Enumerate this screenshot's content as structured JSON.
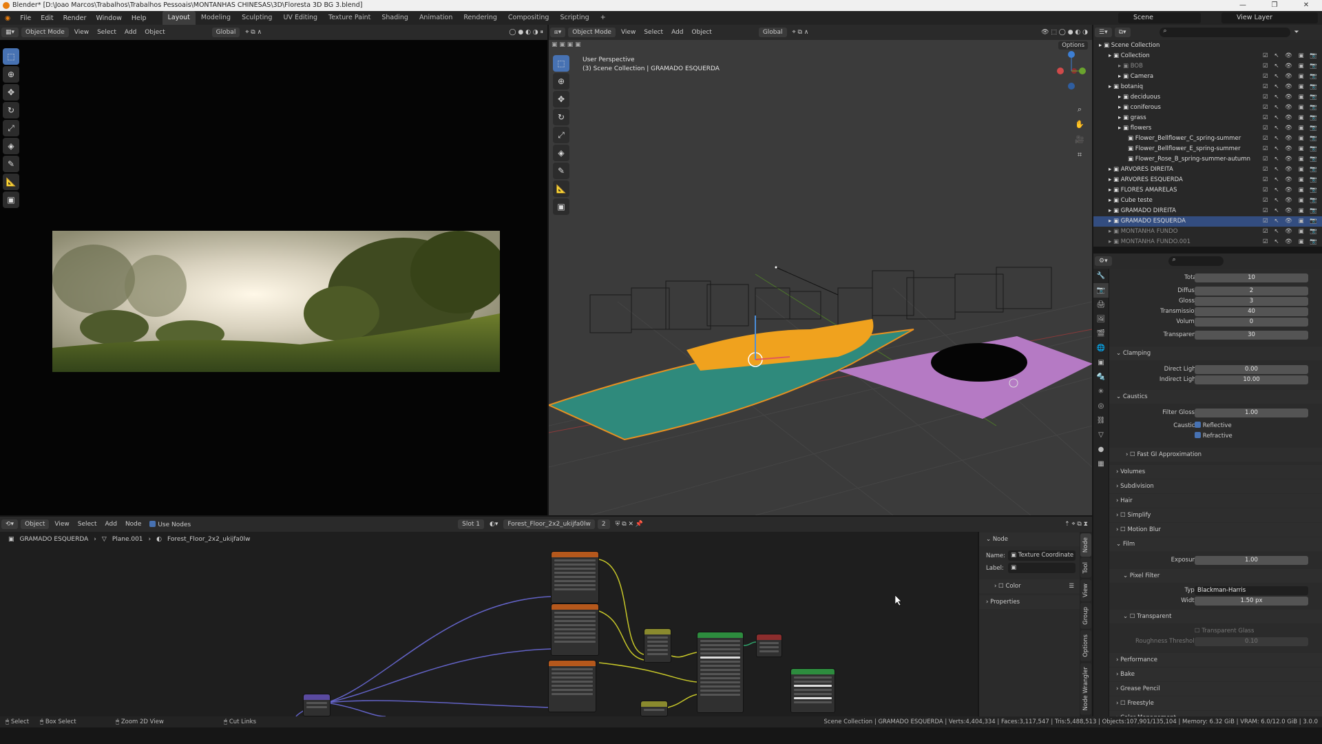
{
  "window": {
    "title": "Blender* [D:\\Joao Marcos\\Trabalhos\\Trabalhos Pessoais\\MONTANHAS CHINESAS\\3D\\Floresta 3D BG 3.blend]"
  },
  "menu": [
    "File",
    "Edit",
    "Render",
    "Window",
    "Help"
  ],
  "workspaces": [
    "Layout",
    "Modeling",
    "Sculpting",
    "UV Editing",
    "Texture Paint",
    "Shading",
    "Animation",
    "Rendering",
    "Compositing",
    "Scripting",
    "+"
  ],
  "top_right": {
    "scene": "Scene",
    "view_layer": "View Layer"
  },
  "left_header": {
    "mode": "Object Mode",
    "view": "View",
    "select": "Select",
    "add": "Add",
    "object": "Object",
    "orientation": "Global"
  },
  "viewport": {
    "mode": "Object Mode",
    "view": "View",
    "select": "Select",
    "add": "Add",
    "object": "Object",
    "orientation": "Global",
    "options": "Options",
    "perspective": "User Perspective",
    "collection_info": "(3) Scene Collection | GRAMADO ESQUERDA"
  },
  "outliner": {
    "rows": [
      {
        "name": "Scene Collection",
        "indent": 0,
        "state": "normal"
      },
      {
        "name": "Collection",
        "indent": 1,
        "state": "normal"
      },
      {
        "name": "BOB",
        "indent": 2,
        "state": "dim"
      },
      {
        "name": "Camera",
        "indent": 2,
        "state": "normal"
      },
      {
        "name": "botaniq",
        "indent": 1,
        "state": "normal"
      },
      {
        "name": "deciduous",
        "indent": 2,
        "state": "normal"
      },
      {
        "name": "coniferous",
        "indent": 2,
        "state": "normal"
      },
      {
        "name": "grass",
        "indent": 2,
        "state": "normal"
      },
      {
        "name": "flowers",
        "indent": 2,
        "state": "normal"
      },
      {
        "name": "Flower_Bellflower_C_spring-summer",
        "indent": 3,
        "state": "normal"
      },
      {
        "name": "Flower_Bellflower_E_spring-summer",
        "indent": 3,
        "state": "normal"
      },
      {
        "name": "Flower_Rose_B_spring-summer-autumn",
        "indent": 3,
        "state": "normal"
      },
      {
        "name": "ARVORES DIREITA",
        "indent": 1,
        "state": "normal"
      },
      {
        "name": "ARVORES ESQUERDA",
        "indent": 1,
        "state": "normal"
      },
      {
        "name": "FLORES AMARELAS",
        "indent": 1,
        "state": "normal"
      },
      {
        "name": "Cube teste",
        "indent": 1,
        "state": "normal"
      },
      {
        "name": "GRAMADO DIREITA",
        "indent": 1,
        "state": "normal"
      },
      {
        "name": "GRAMADO ESQUERDA",
        "indent": 1,
        "state": "selected"
      },
      {
        "name": "MONTANHA FUNDO",
        "indent": 1,
        "state": "dim"
      },
      {
        "name": "MONTANHA FUNDO.001",
        "indent": 1,
        "state": "dim"
      }
    ]
  },
  "properties": {
    "bounces": [
      {
        "label": "Total",
        "value": "10"
      },
      {
        "label": "Diffuse",
        "value": "2"
      },
      {
        "label": "Glossy",
        "value": "3"
      },
      {
        "label": "Transmission",
        "value": "40"
      },
      {
        "label": "Volume",
        "value": "0"
      },
      {
        "label": "Transparent",
        "value": "30"
      }
    ],
    "clamping": {
      "title": "Clamping",
      "direct_label": "Direct Light",
      "direct": "0.00",
      "indirect_label": "Indirect Light",
      "indirect": "10.00"
    },
    "caustics": {
      "title": "Caustics",
      "filter_label": "Filter Glossy",
      "filter": "1.00",
      "caustics_label": "Caustics",
      "reflective": "Reflective",
      "refractive": "Refractive"
    },
    "fast_gi": "Fast GI Approximation",
    "panels1": [
      "Volumes",
      "Subdivision",
      "Hair",
      "Simplify",
      "Motion Blur"
    ],
    "film": {
      "title": "Film",
      "exposure_label": "Exposure",
      "exposure": "1.00",
      "pixel_filter": "Pixel Filter",
      "type_label": "Type",
      "type": "Blackman-Harris",
      "width_label": "Width",
      "width": "1.50 px",
      "transparent": "Transparent",
      "transparent_glass": "Transparent Glass",
      "roughness_label": "Roughness Threshold",
      "roughness": "0.10"
    },
    "panels2": [
      "Performance",
      "Bake",
      "Grease Pencil",
      "Freestyle",
      "Color Management"
    ]
  },
  "node_editor": {
    "header": {
      "type": "Object",
      "view": "View",
      "select": "Select",
      "add": "Add",
      "node": "Node",
      "use_nodes": "Use Nodes",
      "slot": "Slot 1",
      "material": "Forest_Floor_2x2_ukijfa0lw",
      "users": "2"
    },
    "breadcrumb": [
      "GRAMADO ESQUERDA",
      "Plane.001",
      "Forest_Floor_2x2_ukijfa0lw"
    ],
    "sidebar": {
      "section": "Node",
      "name_label": "Name:",
      "name": "Texture Coordinate",
      "label_label": "Label:",
      "color": "Color",
      "properties": "Properties"
    },
    "tabs": [
      "Node",
      "Tool",
      "View",
      "Group",
      "Options",
      "Node Wrangler"
    ]
  },
  "status": {
    "select": "Select",
    "box_select": "Box Select",
    "zoom": "Zoom 2D View",
    "cut": "Cut Links",
    "stats": "Scene Collection | GRAMADO ESQUERDA | Verts:4,404,334 | Faces:3,117,547 | Tris:5,488,513 | Objects:107,901/135,104 | Memory: 6.32 GiB | VRAM: 6.0/12.0 GiB | 3.0.0"
  }
}
